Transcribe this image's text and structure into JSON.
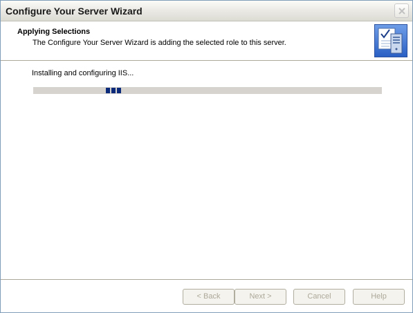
{
  "window": {
    "title": "Configure Your Server Wizard"
  },
  "header": {
    "title": "Applying Selections",
    "subtitle": "The Configure Your Server Wizard is adding the selected role to this server.",
    "icon": "server-wizard-icon"
  },
  "main": {
    "status_text": "Installing and configuring IIS...",
    "progress": {
      "style": "marquee",
      "blocks": 3,
      "fill_color": "#0b2a7a",
      "track_color": "#d6d3ce"
    }
  },
  "buttons": {
    "back_label": "< Back",
    "next_label": "Next >",
    "cancel_label": "Cancel",
    "help_label": "Help",
    "enabled": false
  },
  "colors": {
    "title_close_accent": "#c1c1c1",
    "separator": "#aca899",
    "disabled_text": "#aca899"
  }
}
